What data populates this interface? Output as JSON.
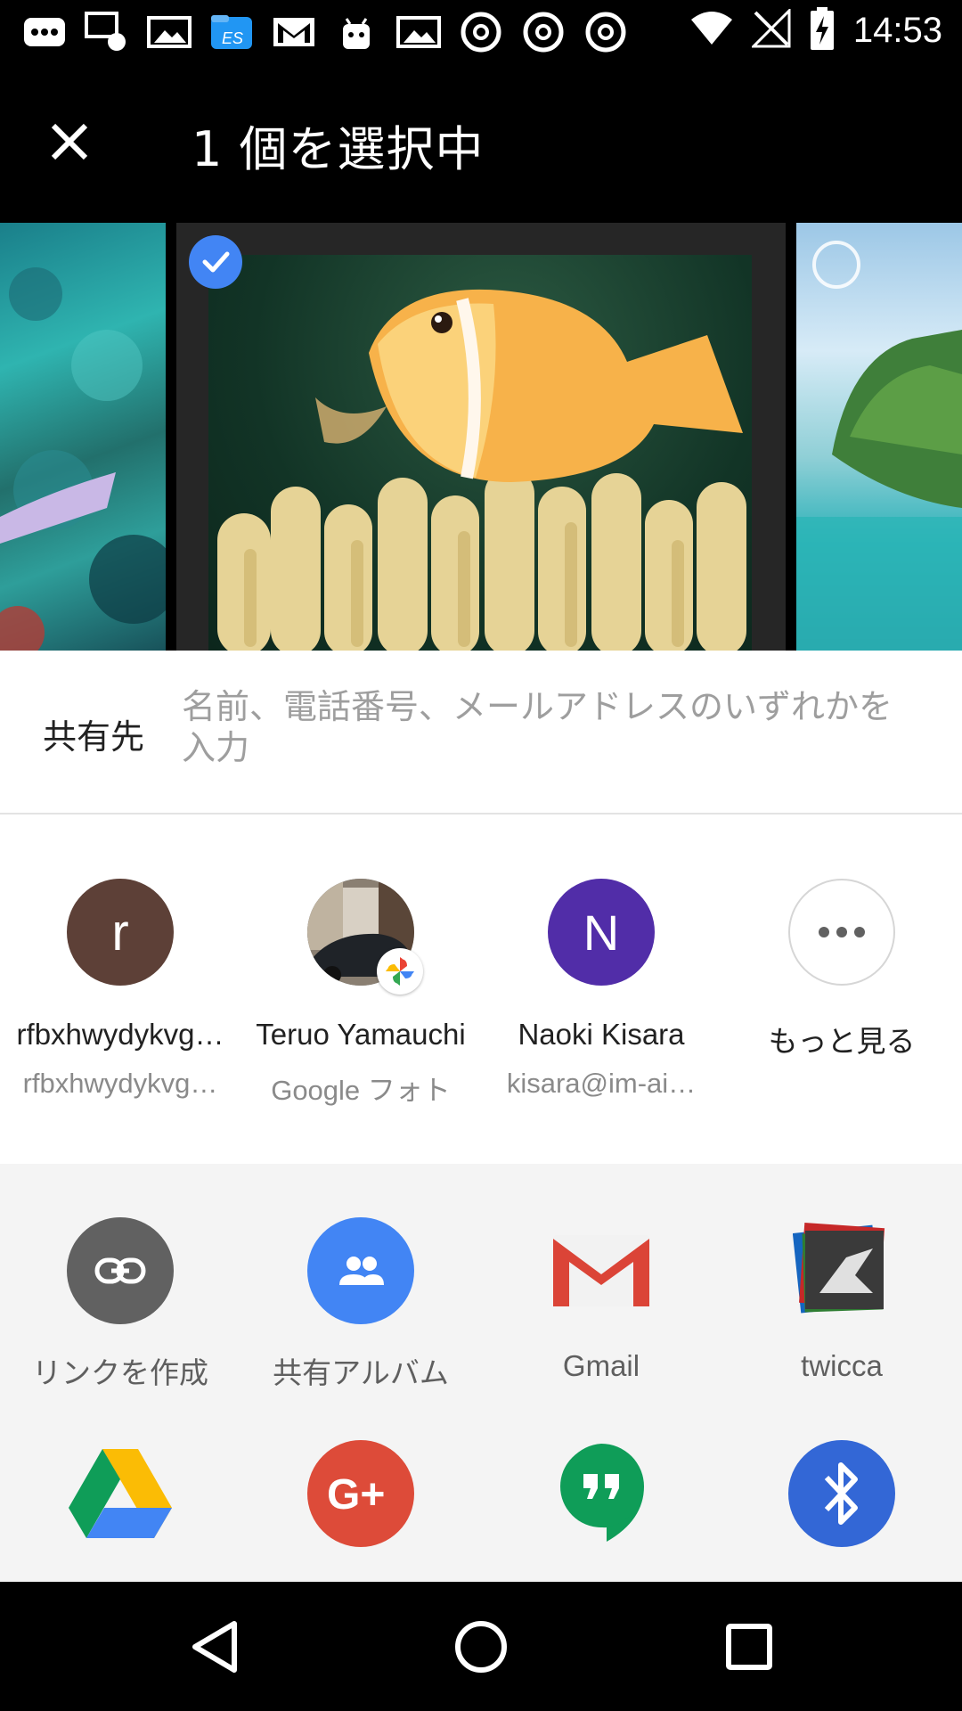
{
  "status_bar": {
    "time": "14:53",
    "notification_icons": [
      "messages-icon",
      "mail-pics-icon",
      "gallery-icon",
      "es-file-explorer-icon",
      "gmail-icon",
      "android-icon",
      "gallery-icon",
      "chrome-icon",
      "chrome-icon",
      "chrome-icon"
    ],
    "system_icons": [
      "wifi-icon",
      "no-signal-icon",
      "battery-charging-icon"
    ]
  },
  "app_bar": {
    "close_icon": "close-icon",
    "title": "1 個を選択中"
  },
  "photos": [
    {
      "name": "coral-reef-fish-photo",
      "selected": false
    },
    {
      "name": "clownfish-anemone-photo",
      "selected": true
    },
    {
      "name": "tropical-island-photo",
      "selected": false
    }
  ],
  "share_to": {
    "label": "共有先",
    "placeholder": "名前、電話番号、メールアドレスのいずれかを入力"
  },
  "contacts": [
    {
      "initial": "r",
      "name": "rfbxhwydykvg…",
      "sub": "rfbxhwydykvg…",
      "color": "#5d4037"
    },
    {
      "initial": "",
      "name": "Teruo Yamauchi",
      "sub": "Google フォト",
      "color": "#444444"
    },
    {
      "initial": "N",
      "name": "Naoki Kisara",
      "sub": "kisara@im-ai…",
      "color": "#512da8"
    },
    {
      "initial": "",
      "name": "もっと見る",
      "sub": "",
      "color": "#ffffff"
    }
  ],
  "apps_row1": [
    {
      "label": "リンクを作成",
      "icon": "link-icon",
      "color": "#616161"
    },
    {
      "label": "共有アルバム",
      "icon": "people-icon",
      "color": "#4285f4"
    },
    {
      "label": "Gmail",
      "icon": "gmail-icon",
      "color": "#db4437"
    },
    {
      "label": "twicca",
      "icon": "twicca-icon",
      "color": "#333333"
    }
  ],
  "apps_row2": [
    {
      "icon": "google-drive-icon"
    },
    {
      "icon": "google-plus-icon",
      "color": "#dd4b39"
    },
    {
      "icon": "hangouts-icon",
      "color": "#0f9d58"
    },
    {
      "icon": "bluetooth-icon",
      "color": "#3367d6"
    }
  ],
  "nav_bar": {
    "back": "back-icon",
    "home": "home-icon",
    "recents": "recents-icon"
  }
}
